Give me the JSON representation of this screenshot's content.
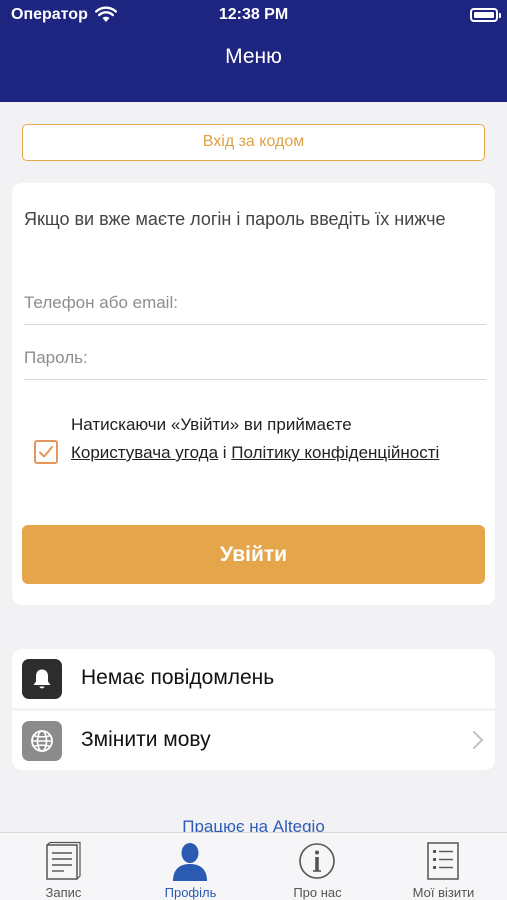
{
  "status_bar": {
    "carrier": "Оператор",
    "time": "12:38 PM"
  },
  "header": {
    "title": "Меню"
  },
  "code_login": {
    "label": "Вхід за кодом"
  },
  "login_card": {
    "intro": "Якщо ви вже маєте логін і пароль введіть їх нижче",
    "phone_placeholder": "Телефон або email:",
    "password_placeholder": "Пароль:",
    "consent_checked": true,
    "consent_prefix": "Натискаючи «Увійти» ви приймаєте",
    "user_agreement_link": "Користувача угода",
    "consent_conjunction": "і",
    "privacy_link": "Політику конфіденційності",
    "submit_label": "Увійти"
  },
  "settings": [
    {
      "label": "Немає повідомлень",
      "icon": "bell-icon",
      "icon_bg": "#2d2d2d"
    },
    {
      "label": "Змінити мову",
      "icon": "globe-icon",
      "icon_bg": "#8b8b8b"
    }
  ],
  "footer_link": "Працює на Altegio",
  "tabs": [
    {
      "label": "Запис",
      "icon": "document-icon",
      "active": false
    },
    {
      "label": "Профіль",
      "icon": "user-icon",
      "active": true
    },
    {
      "label": "Про нас",
      "icon": "info-icon",
      "active": false
    },
    {
      "label": "Мої візити",
      "icon": "list-icon",
      "active": false
    }
  ],
  "colors": {
    "header": "#1d2580",
    "accent": "#e4a54b",
    "link": "#2b5ab3"
  }
}
